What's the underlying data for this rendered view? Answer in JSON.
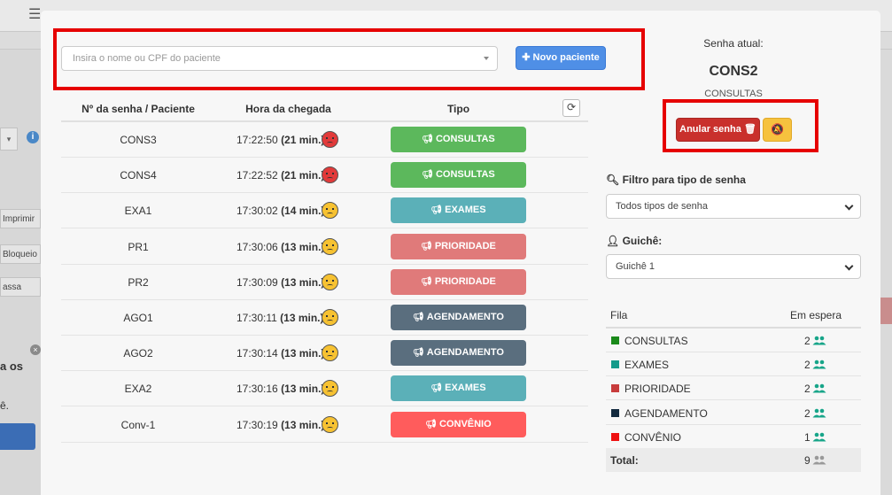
{
  "background": {
    "menu_icon": "hamburger-icon",
    "buttons": [
      "Imprimir",
      "Bloqueio",
      "assa"
    ],
    "text_fragments": [
      "a os",
      "ê."
    ]
  },
  "search": {
    "placeholder": "Insira o nome ou CPF do paciente"
  },
  "new_patient_label": "Novo paciente",
  "table": {
    "headers": {
      "ticket": "Nº da senha / Paciente",
      "arrival": "Hora da chegada",
      "type": "Tipo"
    },
    "rows": [
      {
        "ticket": "CONS3",
        "time": "17:22:50",
        "wait": "(21 min.)",
        "mood": "angry",
        "type": "CONSULTAS",
        "color": "#5cb85c"
      },
      {
        "ticket": "CONS4",
        "time": "17:22:52",
        "wait": "(21 min.)",
        "mood": "angry",
        "type": "CONSULTAS",
        "color": "#5cb85c"
      },
      {
        "ticket": "EXA1",
        "time": "17:30:02",
        "wait": "(14 min.)",
        "mood": "sad",
        "type": "EXAMES",
        "color": "#5bb0b8"
      },
      {
        "ticket": "PR1",
        "time": "17:30:06",
        "wait": "(13 min.)",
        "mood": "sad",
        "type": "PRIORIDADE",
        "color": "#e07a7a"
      },
      {
        "ticket": "PR2",
        "time": "17:30:09",
        "wait": "(13 min.)",
        "mood": "sad",
        "type": "PRIORIDADE",
        "color": "#e07a7a"
      },
      {
        "ticket": "AGO1",
        "time": "17:30:11",
        "wait": "(13 min.)",
        "mood": "sad",
        "type": "AGENDAMENTO",
        "color": "#5a6e7e"
      },
      {
        "ticket": "AGO2",
        "time": "17:30:14",
        "wait": "(13 min.)",
        "mood": "sad",
        "type": "AGENDAMENTO",
        "color": "#5a6e7e"
      },
      {
        "ticket": "EXA2",
        "time": "17:30:16",
        "wait": "(13 min.)",
        "mood": "sad",
        "type": "EXAMES",
        "color": "#5bb0b8"
      },
      {
        "ticket": "Conv-1",
        "time": "17:30:19",
        "wait": "(13 min.)",
        "mood": "sad",
        "type": "CONVÊNIO",
        "color": "#ff5c5c"
      }
    ]
  },
  "current": {
    "label": "Senha atual:",
    "ticket": "CONS2",
    "type": "CONSULTAS"
  },
  "cancel_label": "Anular senha",
  "filter": {
    "label": "Filtro para tipo de senha",
    "value": "Todos tipos de senha"
  },
  "counter": {
    "label": "Guichê:",
    "value": "Guichê 1"
  },
  "queue": {
    "headers": {
      "queue": "Fila",
      "waiting": "Em espera"
    },
    "rows": [
      {
        "name": "CONSULTAS",
        "count": "2",
        "color": "#1a8a1a"
      },
      {
        "name": "EXAMES",
        "count": "2",
        "color": "#159a8a"
      },
      {
        "name": "PRIORIDADE",
        "count": "2",
        "color": "#c83c3c"
      },
      {
        "name": "AGENDAMENTO",
        "count": "2",
        "color": "#132a3e"
      },
      {
        "name": "CONVÊNIO",
        "count": "1",
        "color": "#ee1111"
      }
    ],
    "total_label": "Total:",
    "total": "9"
  }
}
